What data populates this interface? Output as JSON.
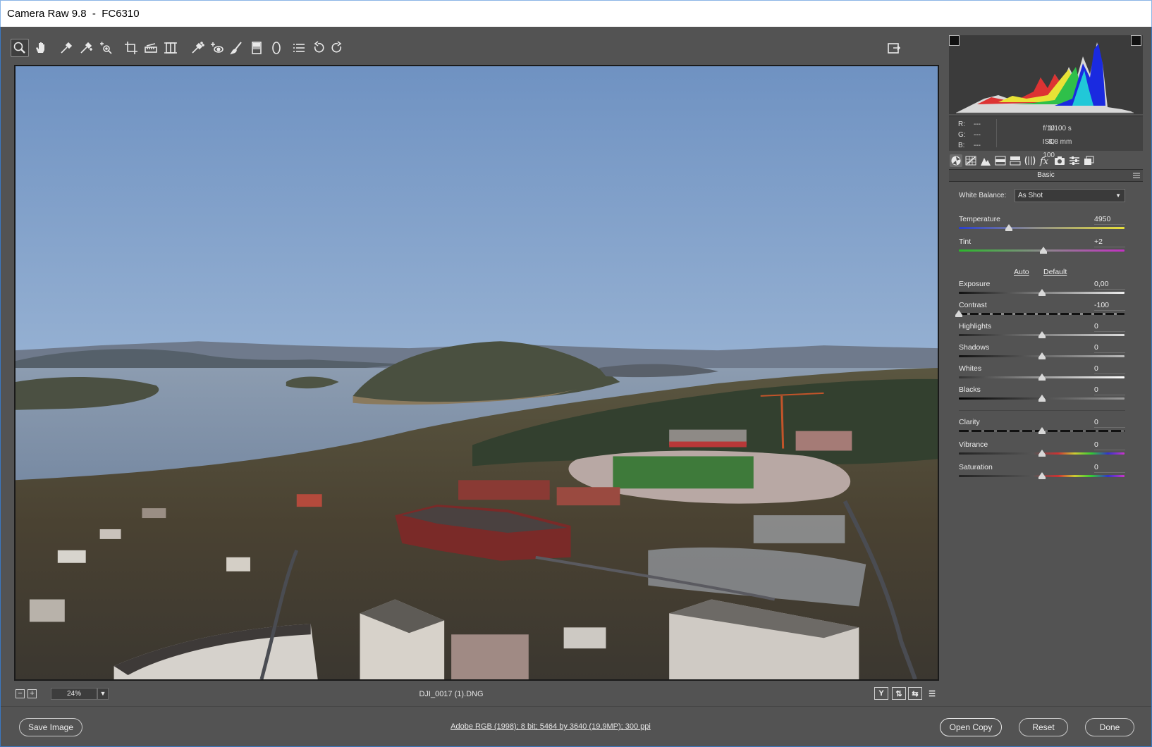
{
  "window": {
    "title": "Camera Raw 9.8  -  FC6310"
  },
  "toolbar": {
    "tools": [
      {
        "name": "zoom-tool-icon"
      },
      {
        "name": "hand-tool-icon"
      },
      {
        "name": "white-balance-tool-icon"
      },
      {
        "name": "color-sampler-tool-icon"
      },
      {
        "name": "targeted-adjustment-tool-icon"
      },
      {
        "name": "crop-tool-icon"
      },
      {
        "name": "straighten-tool-icon"
      },
      {
        "name": "transform-tool-icon"
      },
      {
        "name": "spot-removal-tool-icon"
      },
      {
        "name": "red-eye-tool-icon"
      },
      {
        "name": "adjustment-brush-icon"
      },
      {
        "name": "graduated-filter-icon"
      },
      {
        "name": "radial-filter-icon"
      },
      {
        "name": "preferences-icon"
      },
      {
        "name": "rotate-left-icon"
      },
      {
        "name": "rotate-right-icon"
      }
    ],
    "fullscreen_icon": "toggle-fullscreen-icon"
  },
  "preview": {
    "zoom": "24%",
    "filename": "DJI_0017 (1).DNG",
    "view_buttons": [
      "Y",
      "before-after-icon",
      "swap-icon",
      "settings-icon"
    ]
  },
  "readout": {
    "r_label": "R:",
    "r_value": "---",
    "g_label": "G:",
    "g_value": "---",
    "b_label": "B:",
    "b_value": "---",
    "aperture": "f/10",
    "shutter": "1/100 s",
    "iso": "ISO 100",
    "focal": "8,8 mm"
  },
  "panel": {
    "title": "Basic",
    "white_balance_label": "White Balance:",
    "white_balance_value": "As Shot",
    "auto_label": "Auto",
    "default_label": "Default",
    "sliders": [
      {
        "id": "temperature",
        "label": "Temperature",
        "value": "4950",
        "position": 0.3
      },
      {
        "id": "tint",
        "label": "Tint",
        "value": "+2",
        "position": 0.51
      },
      {
        "id": "exposure",
        "label": "Exposure",
        "value": "0,00",
        "position": 0.5
      },
      {
        "id": "contrast",
        "label": "Contrast",
        "value": "-100",
        "position": 0.0
      },
      {
        "id": "highlights",
        "label": "Highlights",
        "value": "0",
        "position": 0.5
      },
      {
        "id": "shadows",
        "label": "Shadows",
        "value": "0",
        "position": 0.5
      },
      {
        "id": "whites",
        "label": "Whites",
        "value": "0",
        "position": 0.5
      },
      {
        "id": "blacks",
        "label": "Blacks",
        "value": "0",
        "position": 0.5
      },
      {
        "id": "clarity",
        "label": "Clarity",
        "value": "0",
        "position": 0.5
      },
      {
        "id": "vibrance",
        "label": "Vibrance",
        "value": "0",
        "position": 0.5
      },
      {
        "id": "saturation",
        "label": "Saturation",
        "value": "0",
        "position": 0.5
      }
    ]
  },
  "bottom": {
    "save_label": "Save Image",
    "workflow_label": "Adobe RGB (1998); 8 bit; 5464 by 3640 (19,9MP); 300 ppi",
    "open_label": "Open Copy",
    "reset_label": "Reset",
    "done_label": "Done"
  },
  "colors": {
    "ui_background": "#535353",
    "panel_dark": "#3b3b3b",
    "accent_border": "#3a78c2"
  }
}
